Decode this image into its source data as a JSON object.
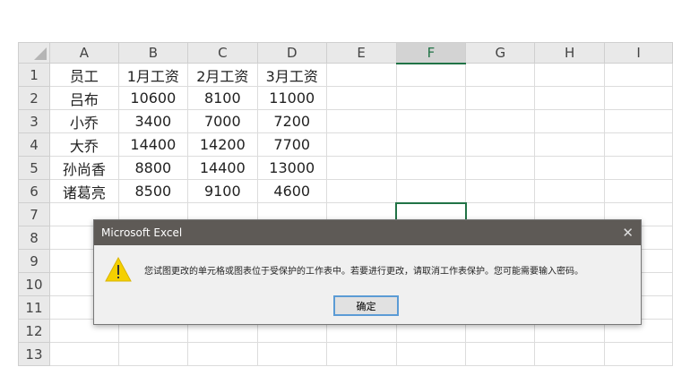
{
  "columns": [
    "A",
    "B",
    "C",
    "D",
    "E",
    "F",
    "G",
    "H",
    "I"
  ],
  "rows": [
    [
      "员工",
      "1月工资",
      "2月工资",
      "3月工资",
      "",
      "",
      "",
      "",
      ""
    ],
    [
      "吕布",
      "10600",
      "8100",
      "11000",
      "",
      "",
      "",
      "",
      ""
    ],
    [
      "小乔",
      "3400",
      "7000",
      "7200",
      "",
      "",
      "",
      "",
      ""
    ],
    [
      "大乔",
      "14400",
      "14200",
      "7700",
      "",
      "",
      "",
      "",
      ""
    ],
    [
      "孙尚香",
      "8800",
      "14400",
      "13000",
      "",
      "",
      "",
      "",
      ""
    ],
    [
      "诸葛亮",
      "8500",
      "9100",
      "4600",
      "",
      "",
      "",
      "",
      ""
    ],
    [
      "",
      "",
      "",
      "",
      "",
      "",
      "",
      "",
      ""
    ],
    [
      "",
      "",
      "",
      "",
      "",
      "",
      "",
      "",
      ""
    ],
    [
      "",
      "",
      "",
      "",
      "",
      "",
      "",
      "",
      ""
    ],
    [
      "",
      "",
      "",
      "",
      "",
      "",
      "",
      "",
      ""
    ],
    [
      "",
      "",
      "",
      "",
      "",
      "",
      "",
      "",
      ""
    ],
    [
      "",
      "",
      "",
      "",
      "",
      "",
      "",
      "",
      ""
    ],
    [
      "",
      "",
      "",
      "",
      "",
      "",
      "",
      "",
      ""
    ]
  ],
  "selected_cell": "F7",
  "dialog": {
    "title": "Microsoft Excel",
    "close_icon": "close-icon",
    "icon": "warning-icon",
    "message": "您试图更改的单元格或图表位于受保护的工作表中。若要进行更改，请取消工作表保护。您可能需要输入密码。",
    "ok_label": "确定"
  },
  "colors": {
    "accent": "#217346",
    "titlebar": "#5e5a56",
    "warning": "#f5d000"
  }
}
